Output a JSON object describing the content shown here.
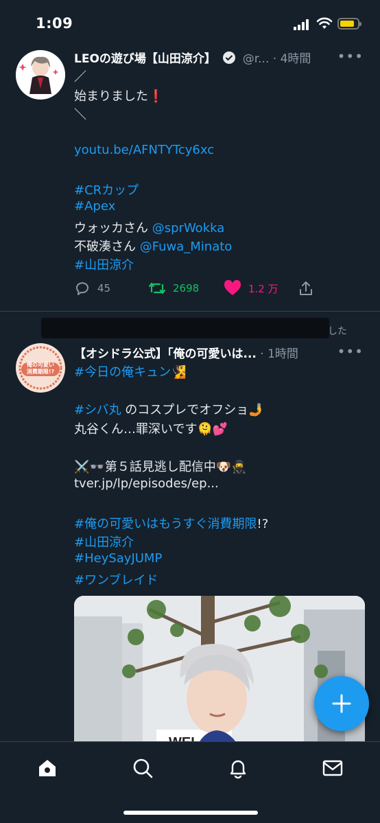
{
  "status_bar": {
    "time": "1:09"
  },
  "tweet1": {
    "name": "LEOの遊び場【山田涼介】",
    "handle": "@r...",
    "time": "· 4時間",
    "lines": [
      "／",
      "始まりました❗",
      "＼",
      "",
      "youtu.be/AFNTYTcy6xc",
      "",
      "#CRカップ",
      "#Apex"
    ],
    "line_wokka_prefix": "ウォッカさん ",
    "line_wokka_mention": "@sprWokka",
    "line_fuwa_prefix": "不破湊さん ",
    "line_fuwa_mention": "@Fuwa_Minato",
    "line_last": "#山田涼介",
    "replies": "45",
    "retweets": "2698",
    "likes": "1.2 万"
  },
  "tweet2": {
    "retweet_tail": "した",
    "avatar_text": "俺の可愛い消費期限!?",
    "name": "【オシドラ公式】「俺の可愛いは...",
    "time": "· 1時間",
    "l1_tag": "#今日の俺キュン",
    "l1_emoji": "🧏",
    "l2_tag": "#シバ丸",
    "l2_text": " のコスプレでオフショ🤳",
    "l3": "丸谷くん…罪深いです🫠💕",
    "l4": "⚔️👓第５話見逃し配信中🐶🥷",
    "l5": "tver.jp/lp/episodes/ep...",
    "l6_tag": "#俺の可愛いはもうすぐ消費期限",
    "l6_text": "!?",
    "l7": "#山田涼介",
    "l8": "#HeySayJUMP",
    "l9": "#ワンブレイド",
    "photo_sign": "WEL"
  },
  "colors": {
    "background": "#15202b",
    "accent": "#1d9bf0",
    "retweet": "#17bf63",
    "like": "#f91880",
    "muted": "#8b98a5"
  },
  "icons": [
    "reply-icon",
    "retweet-icon",
    "heart-icon",
    "share-icon",
    "verified-icon",
    "home-icon",
    "search-icon",
    "bell-icon",
    "mail-icon",
    "compose-plus-icon"
  ]
}
